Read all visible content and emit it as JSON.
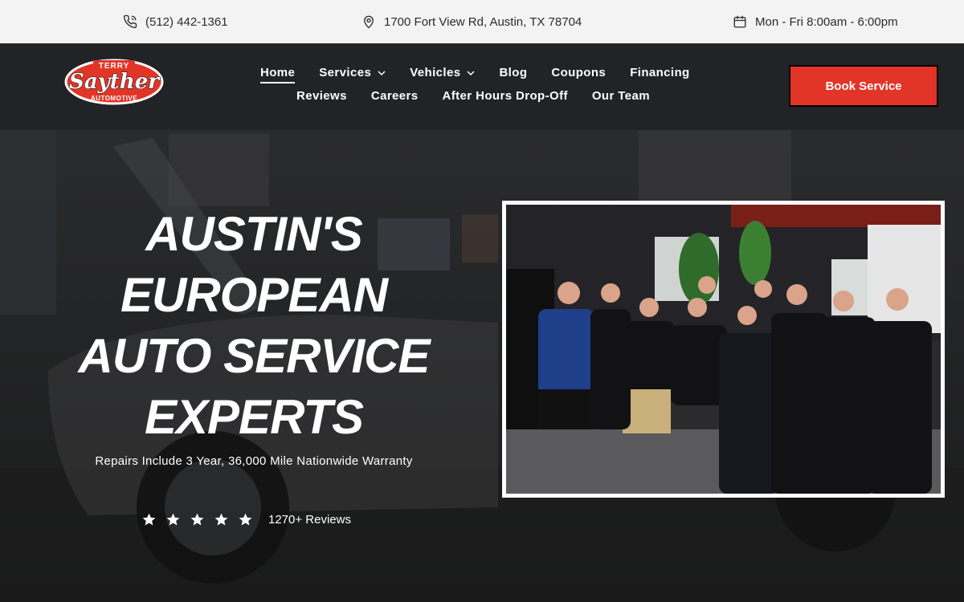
{
  "topbar": {
    "phone": "(512) 442-1361",
    "address": "1700 Fort View Rd, Austin, TX 78704",
    "hours": "Mon - Fri 8:00am - 6:00pm",
    "icons": [
      "phone-icon",
      "map-pin-icon",
      "calendar-icon"
    ]
  },
  "logo": {
    "top": "TERRY",
    "name": "Sayther",
    "bottom": "AUTOMOTIVE"
  },
  "nav": {
    "row1": [
      {
        "label": "Home",
        "active": true
      },
      {
        "label": "Services",
        "dropdown": true
      },
      {
        "label": "Vehicles",
        "dropdown": true
      },
      {
        "label": "Blog"
      },
      {
        "label": "Coupons"
      },
      {
        "label": "Financing"
      }
    ],
    "row2": [
      {
        "label": "Reviews"
      },
      {
        "label": "Careers"
      },
      {
        "label": "After Hours Drop-Off"
      },
      {
        "label": "Our Team"
      }
    ]
  },
  "cta": {
    "book_label": "Book Service"
  },
  "hero": {
    "title_lines": [
      "AUSTIN'S",
      "EUROPEAN",
      "AUTO SERVICE",
      "EXPERTS"
    ],
    "warranty": "Repairs Include 3 Year, 36,000 Mile Nationwide Warranty",
    "rating_stars": 5,
    "reviews_text": "1270+ Reviews"
  },
  "colors": {
    "accent": "#e23527",
    "header_bg": "#222326",
    "topbar_bg": "#f3f3f3"
  }
}
